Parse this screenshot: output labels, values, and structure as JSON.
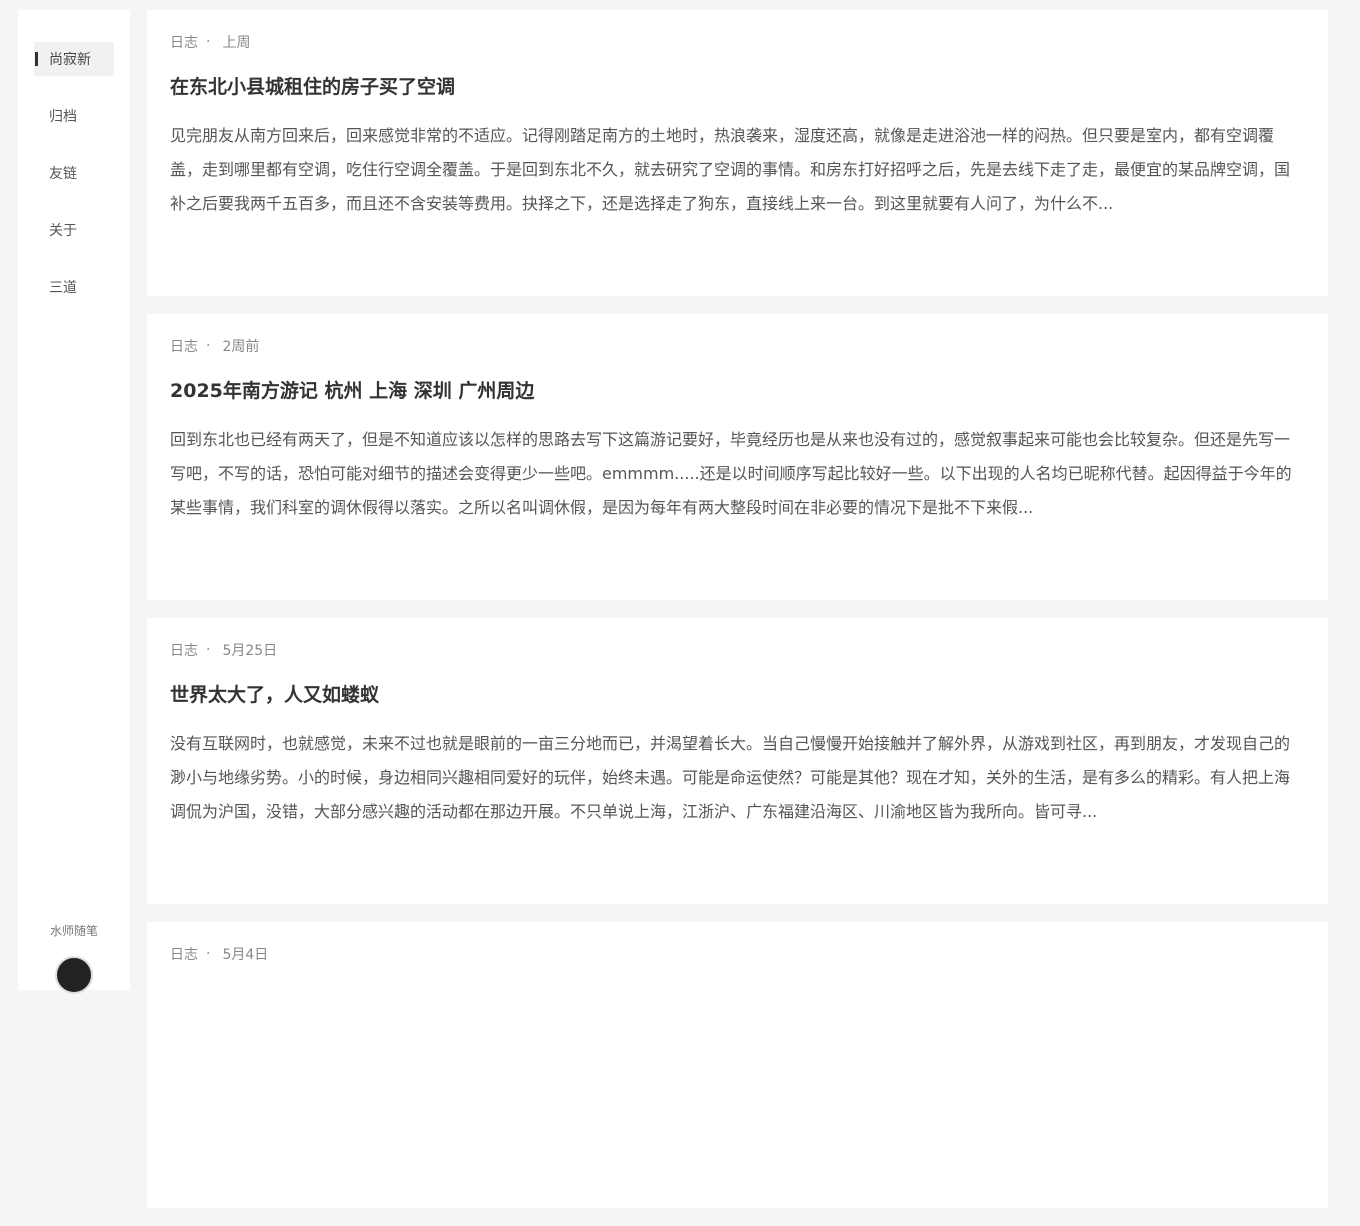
{
  "sidebar": {
    "items": [
      {
        "label": "尚寂新",
        "active": true
      },
      {
        "label": "归档"
      },
      {
        "label": "友链"
      },
      {
        "label": "关于"
      },
      {
        "label": "三道"
      }
    ],
    "footer_label": "水师随笔"
  },
  "posts": [
    {
      "category": "日志",
      "separator": "·",
      "date": "上周",
      "title": "在东北小县城租住的房子买了空调",
      "excerpt": "见完朋友从南方回来后，回来感觉非常的不适应。记得刚踏足南方的土地时，热浪袭来，湿度还高，就像是走进浴池一样的闷热。但只要是室内，都有空调覆盖，走到哪里都有空调，吃住行空调全覆盖。于是回到东北不久，就去研究了空调的事情。和房东打好招呼之后，先是去线下走了走，最便宜的某品牌空调，国补之后要我两千五百多，而且还不含安装等费用。抉择之下，还是选择走了狗东，直接线上来一台。到这里就要有人问了，为什么不..."
    },
    {
      "category": "日志",
      "separator": "·",
      "date": "2周前",
      "title": "2025年南方游记 杭州 上海 深圳 广州周边",
      "excerpt": "回到东北也已经有两天了，但是不知道应该以怎样的思路去写下这篇游记要好，毕竟经历也是从来也没有过的，感觉叙事起来可能也会比较复杂。但还是先写一写吧，不写的话，恐怕可能对细节的描述会变得更少一些吧。emmmm.....还是以时间顺序写起比较好一些。以下出现的人名均已昵称代替。起因得益于今年的某些事情，我们科室的调休假得以落实。之所以名叫调休假，是因为每年有两大整段时间在非必要的情况下是批不下来假..."
    },
    {
      "category": "日志",
      "separator": "·",
      "date": "5月25日",
      "title": "世界太大了，人又如蝼蚁",
      "excerpt": "没有互联网时，也就感觉，未来不过也就是眼前的一亩三分地而已，并渴望着长大。当自己慢慢开始接触并了解外界，从游戏到社区，再到朋友，才发现自己的渺小与地缘劣势。小的时候，身边相同兴趣相同爱好的玩伴，始终未遇。可能是命运使然？可能是其他？现在才知，关外的生活，是有多么的精彩。有人把上海调侃为沪国，没错，大部分感兴趣的活动都在那边开展。不只单说上海，江浙沪、广东福建沿海区、川渝地区皆为我所向。皆可寻..."
    },
    {
      "category": "日志",
      "separator": "·",
      "date": "5月4日",
      "title": "",
      "excerpt": ""
    }
  ]
}
